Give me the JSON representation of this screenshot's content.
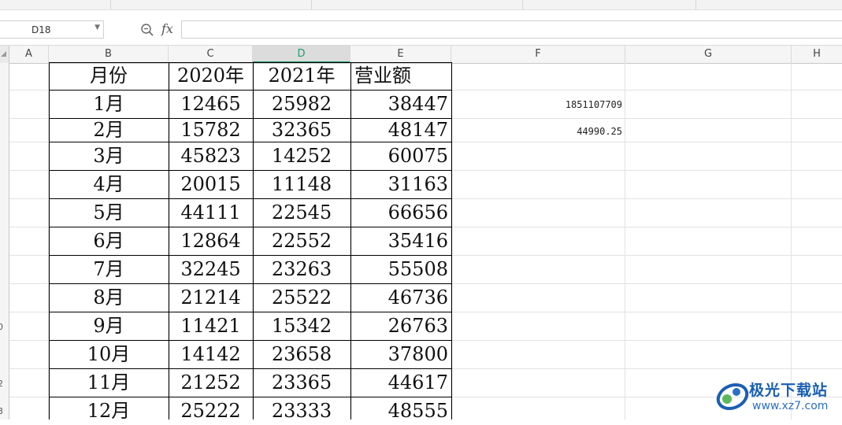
{
  "formula_bar": {
    "cell_reference": "D18",
    "fx_label": "fx",
    "formula_value": ""
  },
  "column_headers": [
    "A",
    "B",
    "C",
    "D",
    "E",
    "F",
    "G",
    "H"
  ],
  "active_column": "D",
  "row_header_fragments": [
    "0",
    "2",
    "3"
  ],
  "table": {
    "headers": [
      "月份",
      "2020年",
      "2021年",
      "营业额"
    ],
    "rows": [
      [
        "1月",
        "12465",
        "25982",
        "38447"
      ],
      [
        "2月",
        "15782",
        "32365",
        "48147"
      ],
      [
        "3月",
        "45823",
        "14252",
        "60075"
      ],
      [
        "4月",
        "20015",
        "11148",
        "31163"
      ],
      [
        "5月",
        "44111",
        "22545",
        "66656"
      ],
      [
        "6月",
        "12864",
        "22552",
        "35416"
      ],
      [
        "7月",
        "32245",
        "23263",
        "55508"
      ],
      [
        "8月",
        "21214",
        "25522",
        "46736"
      ],
      [
        "9月",
        "11421",
        "15342",
        "26763"
      ],
      [
        "10月",
        "14142",
        "23658",
        "37800"
      ],
      [
        "11月",
        "21252",
        "23365",
        "44617"
      ],
      [
        "12月",
        "25222",
        "23333",
        "48555"
      ]
    ]
  },
  "column_f_values": [
    "1851107709",
    "44990.25"
  ],
  "watermark": {
    "title": "极光下载站",
    "url": "www.xz7.com"
  },
  "colors": {
    "active_column_accent": "#1aa06d",
    "watermark_blue": "#1a5fb4"
  }
}
